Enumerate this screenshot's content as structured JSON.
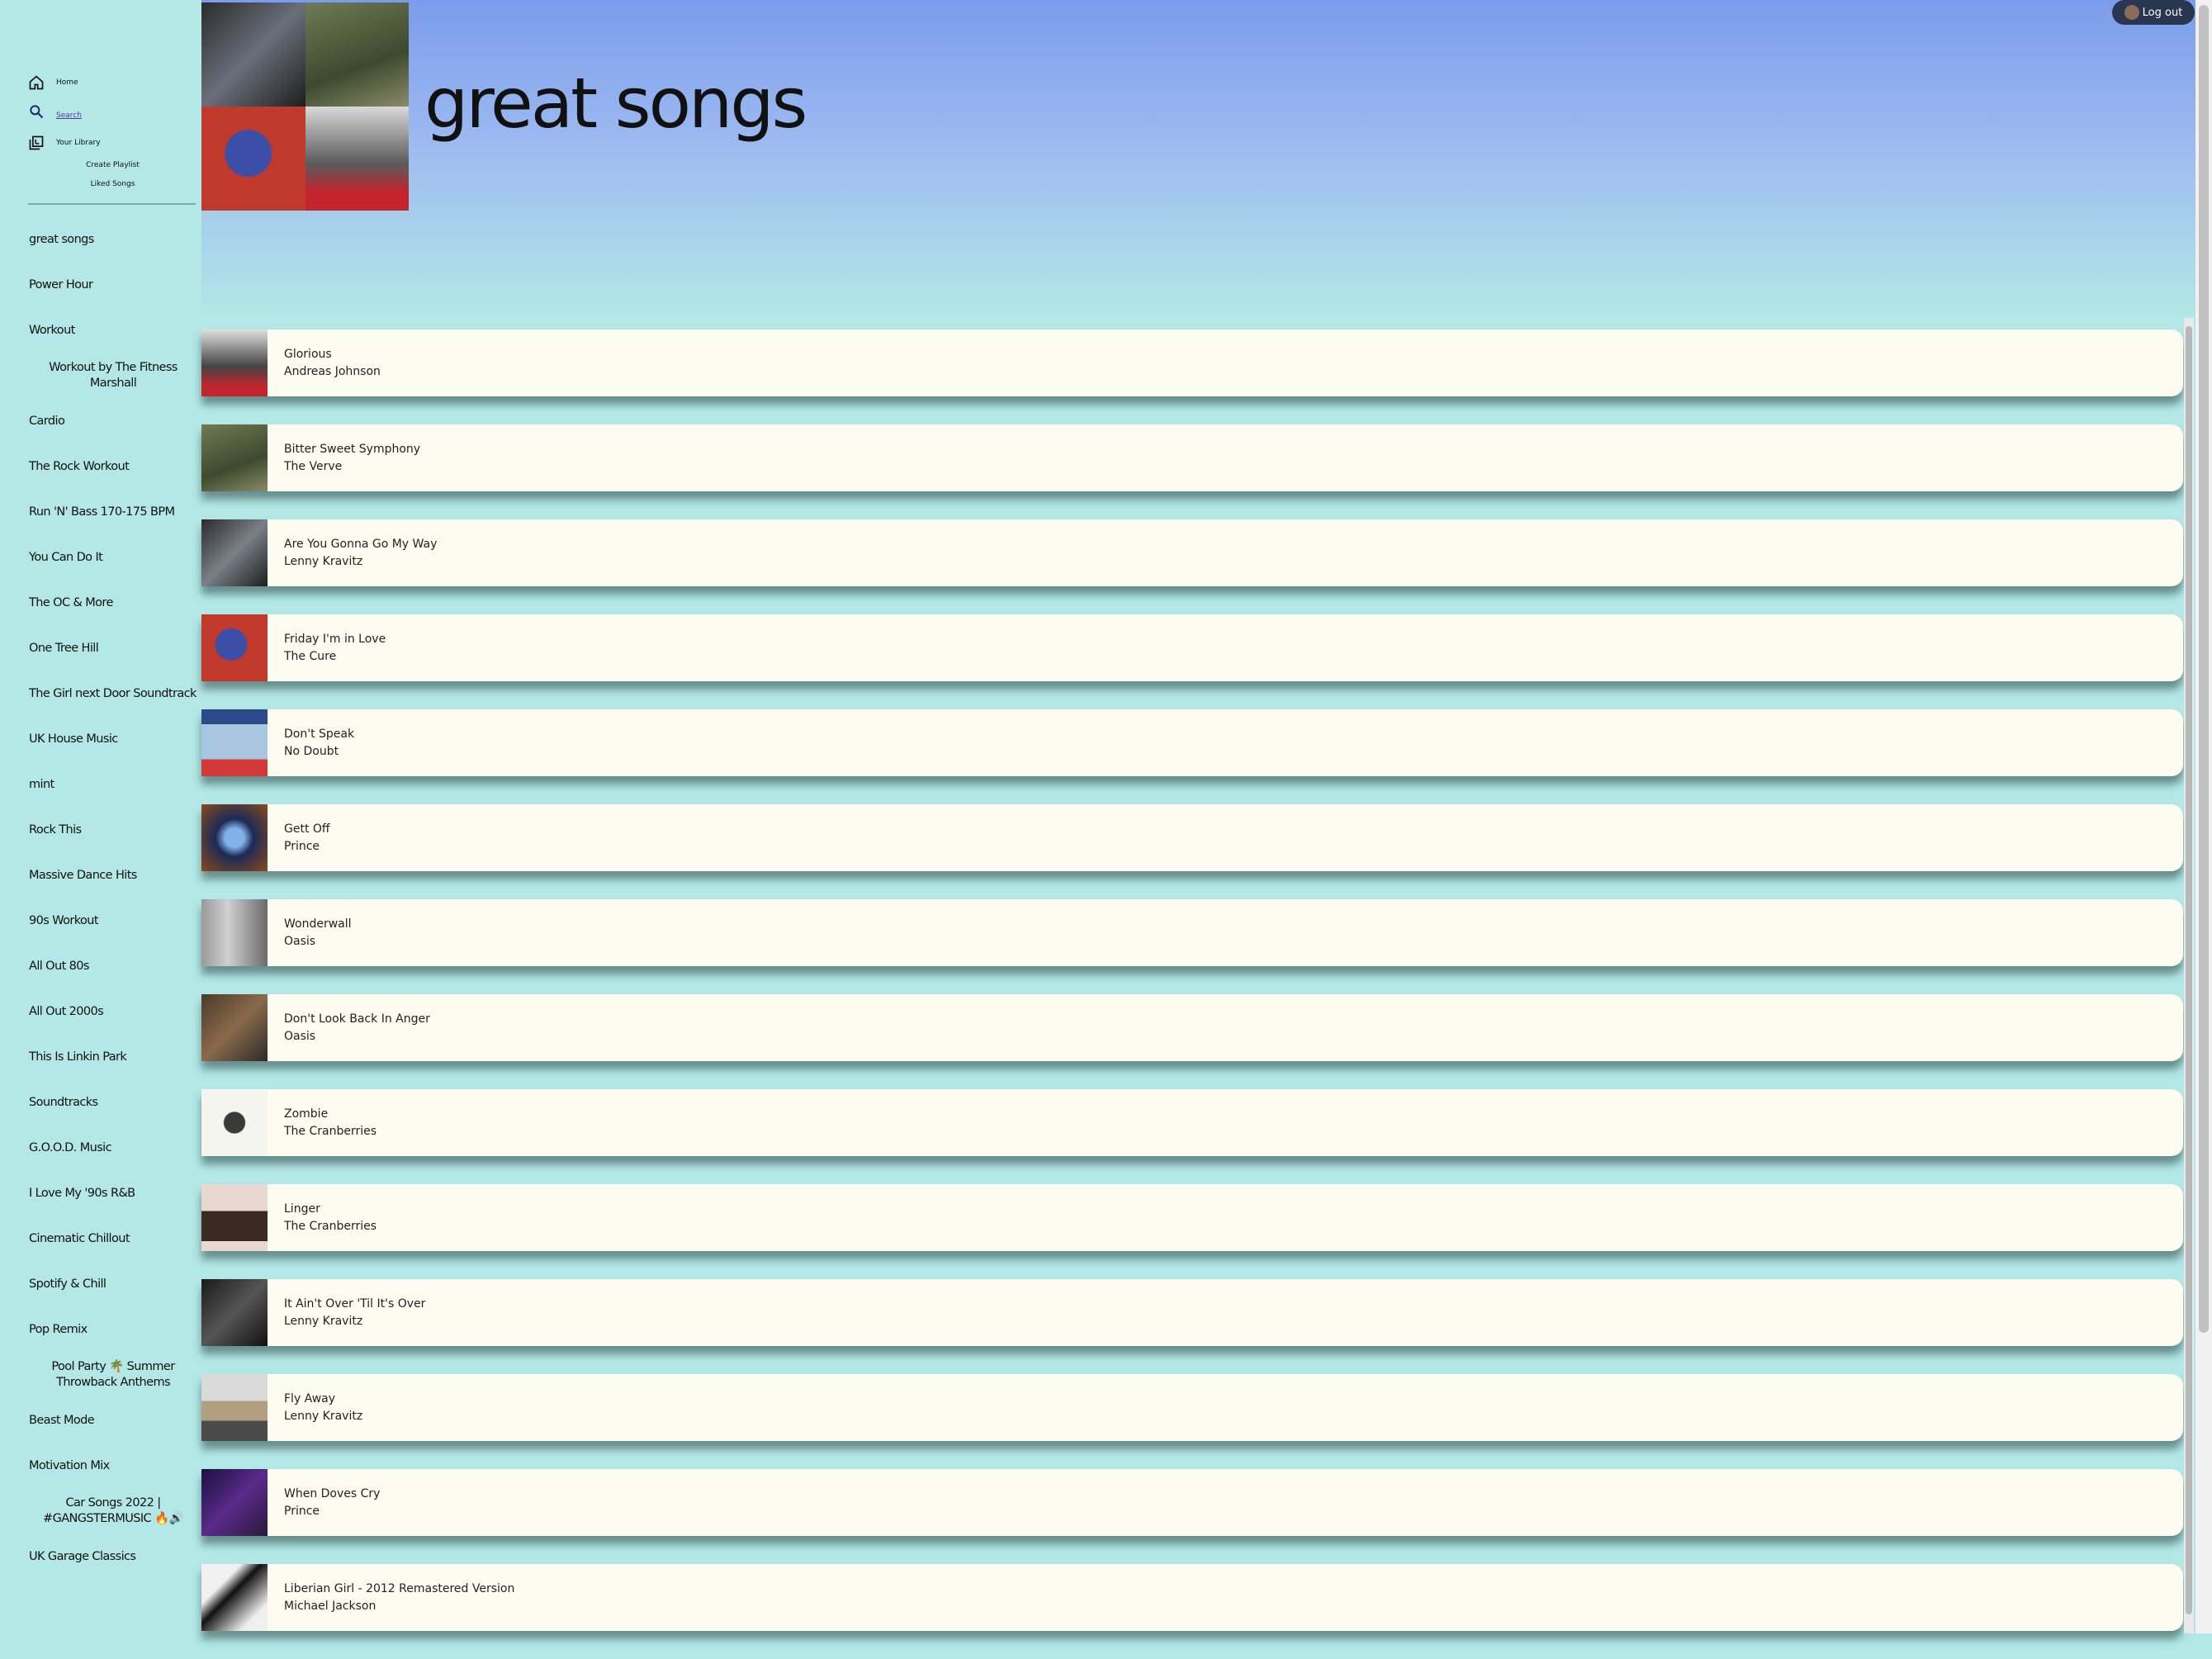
{
  "nav": {
    "home": "Home",
    "search": "Search",
    "library": "Your Library",
    "create_playlist": "Create Playlist",
    "liked_songs": "Liked Songs"
  },
  "playlists": [
    "great songs",
    "Power Hour",
    "Workout",
    "Workout by The Fitness Marshall",
    "Cardio",
    "The Rock Workout",
    "Run 'N' Bass 170-175 BPM",
    "You Can Do It",
    "The OC & More",
    "One Tree Hill",
    "The Girl next Door Soundtrack",
    "UK House Music",
    "mint",
    "Rock This",
    "Massive Dance Hits",
    "90s Workout",
    "All Out 80s",
    "All Out 2000s",
    "This Is Linkin Park",
    "Soundtracks",
    "G.O.O.D. Music",
    "I Love My '90s R&B",
    "Cinematic Chillout",
    "Spotify & Chill",
    "Pop Remix",
    "Pool Party 🌴 Summer Throwback Anthems",
    "Beast Mode",
    "Motivation Mix",
    "Car Songs 2022 | #GANGSTERMUSIC 🔥🔊",
    "UK Garage Classics"
  ],
  "header": {
    "title": "great songs",
    "logout": "Log out"
  },
  "tracks": [
    {
      "title": "Glorious",
      "artist": "Andreas Johnson"
    },
    {
      "title": "Bitter Sweet Symphony",
      "artist": "The Verve"
    },
    {
      "title": "Are You Gonna Go My Way",
      "artist": "Lenny Kravitz"
    },
    {
      "title": "Friday I'm in Love",
      "artist": "The Cure"
    },
    {
      "title": "Don't Speak",
      "artist": "No Doubt"
    },
    {
      "title": "Gett Off",
      "artist": "Prince"
    },
    {
      "title": "Wonderwall",
      "artist": "Oasis"
    },
    {
      "title": "Don't Look Back In Anger",
      "artist": "Oasis"
    },
    {
      "title": "Zombie",
      "artist": "The Cranberries"
    },
    {
      "title": "Linger",
      "artist": "The Cranberries"
    },
    {
      "title": "It Ain't Over 'Til It's Over",
      "artist": "Lenny Kravitz"
    },
    {
      "title": "Fly Away",
      "artist": "Lenny Kravitz"
    },
    {
      "title": "When Doves Cry",
      "artist": "Prince"
    },
    {
      "title": "Liberian Girl - 2012 Remastered Version",
      "artist": "Michael Jackson"
    }
  ],
  "colors": {
    "background": "#b3e8e6",
    "header_top": "#7b9cec",
    "card": "#fdfcf0",
    "logout_bg": "#2a3550"
  }
}
